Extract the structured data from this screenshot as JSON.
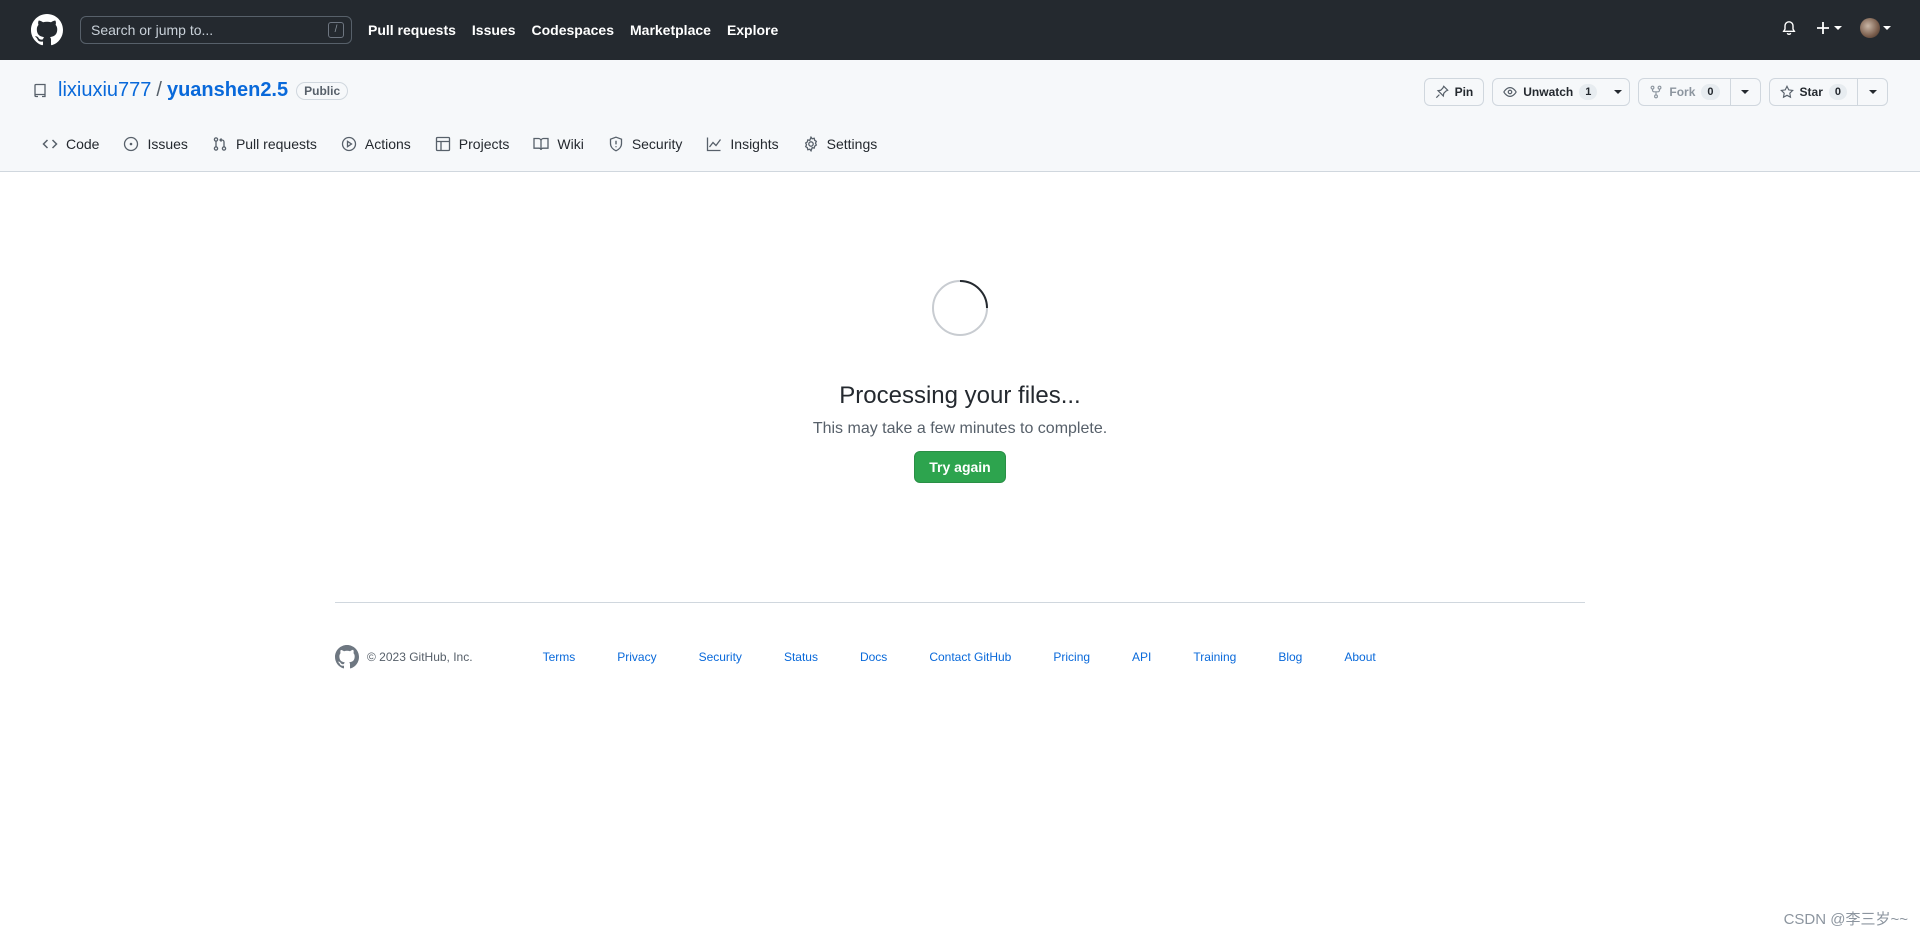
{
  "header": {
    "search_placeholder": "Search or jump to...",
    "search_shortcut": "/",
    "nav": [
      "Pull requests",
      "Issues",
      "Codespaces",
      "Marketplace",
      "Explore"
    ]
  },
  "repo": {
    "owner": "lixiuxiu777",
    "separator": "/",
    "name": "yuanshen2.5",
    "visibility": "Public",
    "actions": {
      "pin_label": "Pin",
      "unwatch_label": "Unwatch",
      "unwatch_count": "1",
      "fork_label": "Fork",
      "fork_count": "0",
      "star_label": "Star",
      "star_count": "0"
    },
    "tabs": [
      "Code",
      "Issues",
      "Pull requests",
      "Actions",
      "Projects",
      "Wiki",
      "Security",
      "Insights",
      "Settings"
    ]
  },
  "main": {
    "title": "Processing your files...",
    "subtitle": "This may take a few minutes to complete.",
    "button_label": "Try again"
  },
  "footer": {
    "copyright": "© 2023 GitHub, Inc.",
    "links": [
      "Terms",
      "Privacy",
      "Security",
      "Status",
      "Docs",
      "Contact GitHub",
      "Pricing",
      "API",
      "Training",
      "Blog",
      "About"
    ]
  },
  "watermark": "CSDN @李三岁~~",
  "colors": {
    "header_bg": "#24292f",
    "link": "#0969da",
    "primary_button": "#2da44e"
  }
}
